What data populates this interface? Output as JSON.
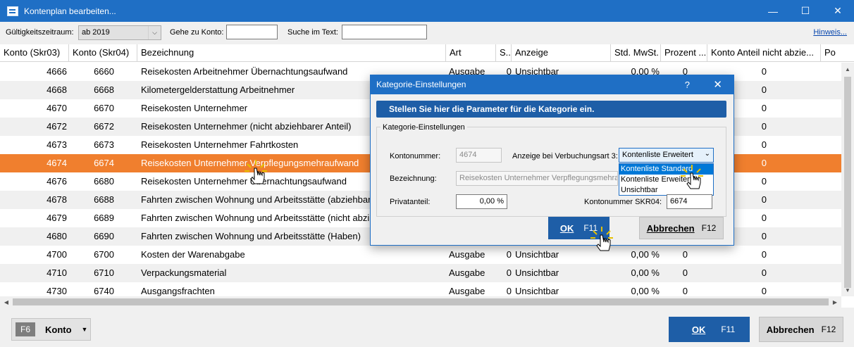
{
  "window": {
    "title": "Kontenplan bearbeiten...",
    "minimize_icon": "minimize-icon",
    "maximize_icon": "maximize-icon",
    "close_icon": "close-icon"
  },
  "toolbar": {
    "validity_label": "Gültigkeitszeitraum:",
    "validity_value": "ab 2019",
    "goto_label": "Gehe zu Konto:",
    "goto_value": "",
    "search_label": "Suche im Text:",
    "search_value": "",
    "hint_link": "Hinweis..."
  },
  "grid": {
    "columns": [
      "Konto (Skr03)",
      "Konto (Skr04)",
      "Bezeichnung",
      "Art",
      "S...",
      "Anzeige",
      "Std. MwSt.",
      "Prozent ...",
      "Konto Anteil nicht abzie...",
      "Po"
    ],
    "rows": [
      {
        "skr03": "4666",
        "skr04": "6660",
        "bez": "Reisekosten Arbeitnehmer Übernachtungsaufwand",
        "art": "Ausgabe",
        "s": "0",
        "anzeige": "Unsichtbar",
        "mwst": "0,00 %",
        "prozent": "0",
        "anteil": "0"
      },
      {
        "skr03": "4668",
        "skr04": "6668",
        "bez": "Kilometergelderstattung Arbeitnehmer",
        "art": "",
        "s": "",
        "anzeige": "",
        "mwst": "",
        "prozent": "",
        "anteil": "0"
      },
      {
        "skr03": "4670",
        "skr04": "6670",
        "bez": "Reisekosten Unternehmer",
        "art": "",
        "s": "",
        "anzeige": "",
        "mwst": "",
        "prozent": "",
        "anteil": "0"
      },
      {
        "skr03": "4672",
        "skr04": "6672",
        "bez": "Reisekosten Unternehmer (nicht abziehbarer Anteil)",
        "art": "",
        "s": "",
        "anzeige": "",
        "mwst": "",
        "prozent": "",
        "anteil": "0"
      },
      {
        "skr03": "4673",
        "skr04": "6673",
        "bez": "Reisekosten Unternehmer Fahrtkosten",
        "art": "",
        "s": "",
        "anzeige": "",
        "mwst": "",
        "prozent": "",
        "anteil": "0"
      },
      {
        "skr03": "4674",
        "skr04": "6674",
        "bez": "Reisekosten Unternehmer Verpflegungsmehraufwand",
        "art": "",
        "s": "",
        "anzeige": "",
        "mwst": "",
        "prozent": "",
        "anteil": "0"
      },
      {
        "skr03": "4676",
        "skr04": "6680",
        "bez": "Reisekosten Unternehmer Übernachtungsaufwand",
        "art": "",
        "s": "",
        "anzeige": "",
        "mwst": "",
        "prozent": "",
        "anteil": "0"
      },
      {
        "skr03": "4678",
        "skr04": "6688",
        "bez": "Fahrten zwischen Wohnung und Arbeitsstätte (abziehbar",
        "art": "",
        "s": "",
        "anzeige": "",
        "mwst": "",
        "prozent": "",
        "anteil": "0"
      },
      {
        "skr03": "4679",
        "skr04": "6689",
        "bez": "Fahrten zwischen Wohnung und Arbeitsstätte (nicht abzi",
        "art": "",
        "s": "",
        "anzeige": "",
        "mwst": "",
        "prozent": "",
        "anteil": "0"
      },
      {
        "skr03": "4680",
        "skr04": "6690",
        "bez": "Fahrten zwischen Wohnung und Arbeitsstätte (Haben)",
        "art": "",
        "s": "",
        "anzeige": "",
        "mwst": "",
        "prozent": "",
        "anteil": "0"
      },
      {
        "skr03": "4700",
        "skr04": "6700",
        "bez": "Kosten der Warenabgabe",
        "art": "Ausgabe",
        "s": "0",
        "anzeige": "Unsichtbar",
        "mwst": "0,00 %",
        "prozent": "0",
        "anteil": "0"
      },
      {
        "skr03": "4710",
        "skr04": "6710",
        "bez": "Verpackungsmaterial",
        "art": "Ausgabe",
        "s": "0",
        "anzeige": "Unsichtbar",
        "mwst": "0,00 %",
        "prozent": "0",
        "anteil": "0"
      },
      {
        "skr03": "4730",
        "skr04": "6740",
        "bez": "Ausgangsfrachten",
        "art": "Ausgabe",
        "s": "0",
        "anzeige": "Unsichtbar",
        "mwst": "0,00 %",
        "prozent": "0",
        "anteil": "0"
      }
    ],
    "selected_index": 5
  },
  "footer": {
    "konto_key": "F6",
    "konto_label": "Konto",
    "ok_label": "OK",
    "ok_key": "F11",
    "cancel_label": "Abbrechen",
    "cancel_key": "F12"
  },
  "dialog": {
    "title": "Kategorie-Einstellungen",
    "help": "?",
    "banner": "Stellen Sie hier die Parameter für die Kategorie ein.",
    "group_title": "Kategorie-Einstellungen",
    "kontonummer_label": "Kontonummer:",
    "kontonummer_value": "4674",
    "anzeige_label": "Anzeige bei Verbuchungsart 3:",
    "anzeige_value": "Kontenliste Erweitert",
    "anzeige_options": [
      "Kontenliste Standard",
      "Kontenliste Erweitert",
      "Unsichtbar"
    ],
    "bezeichnung_label": "Bezeichnung:",
    "bezeichnung_value": "Reisekosten Unternehmer Verpflegungsmehraufwand",
    "privat_label": "Privatanteil:",
    "privat_value": "0,00 %",
    "skr04_label": "Kontonummer SKR04:",
    "skr04_value": "6674",
    "ok_label": "OK",
    "ok_key": "F11",
    "cancel_label": "Abbrechen",
    "cancel_key": "F12"
  },
  "colors": {
    "titlebar": "#1f6fc5",
    "selected_row": "#f07f2e",
    "primary_button": "#1e5ea7"
  }
}
